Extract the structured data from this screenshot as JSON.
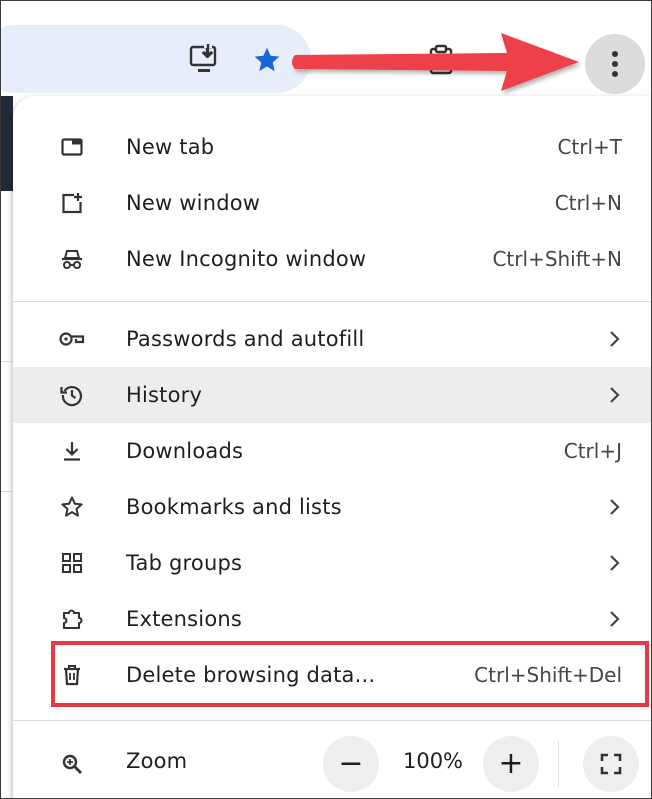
{
  "toolbar": {
    "icons": {
      "install": "install-app-icon",
      "bookmark": "star-icon",
      "clipboard": "clipboard-icon",
      "menu": "three-dot-menu-icon"
    },
    "colors": {
      "star": "#1a66d6",
      "omnibox": "#e8eef9",
      "annotation": "#e63b47"
    }
  },
  "menu": {
    "group1": [
      {
        "label": "New tab",
        "shortcut": "Ctrl+T",
        "icon": "new-tab-icon"
      },
      {
        "label": "New window",
        "shortcut": "Ctrl+N",
        "icon": "new-window-icon"
      },
      {
        "label": "New Incognito window",
        "shortcut": "Ctrl+Shift+N",
        "icon": "incognito-icon"
      }
    ],
    "group2": [
      {
        "label": "Passwords and autofill",
        "icon": "key-icon",
        "submenu": true
      },
      {
        "label": "History",
        "icon": "history-icon",
        "submenu": true,
        "hovered": true
      },
      {
        "label": "Downloads",
        "shortcut": "Ctrl+J",
        "icon": "download-icon"
      },
      {
        "label": "Bookmarks and lists",
        "icon": "star-outline-icon",
        "submenu": true
      },
      {
        "label": "Tab groups",
        "icon": "tab-groups-icon",
        "submenu": true
      },
      {
        "label": "Extensions",
        "icon": "puzzle-icon",
        "submenu": true
      },
      {
        "label": "Delete browsing data...",
        "shortcut": "Ctrl+Shift+Del",
        "icon": "trash-icon",
        "highlighted": true
      }
    ],
    "zoom": {
      "label": "Zoom",
      "value": "100%",
      "minus": "−",
      "plus": "+"
    }
  }
}
